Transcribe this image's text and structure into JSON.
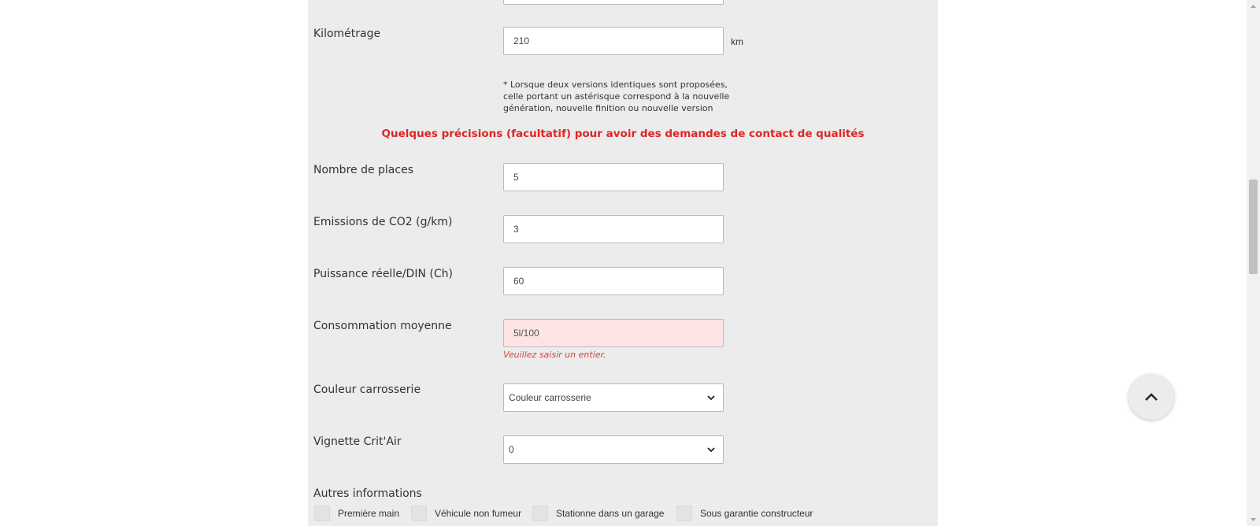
{
  "form": {
    "kilometrage": {
      "label": "Kilométrage",
      "value": "210",
      "unit": "km"
    },
    "note": "* Lorsque deux versions identiques sont proposées, celle portant un astérisque correspond à la nouvelle génération, nouvelle finition ou nouvelle version",
    "section_title": "Quelques précisions (facultatif) pour avoir des demandes de contact de qualités",
    "places": {
      "label": "Nombre de places",
      "value": "5"
    },
    "co2": {
      "label": "Emissions de CO2 (g/km)",
      "value": "3"
    },
    "puissance": {
      "label": "Puissance réelle/DIN (Ch)",
      "value": "60"
    },
    "consommation": {
      "label": "Consommation moyenne",
      "value": "5l/100",
      "error": "Veuillez saisir un entier."
    },
    "couleur": {
      "label": "Couleur carrosserie",
      "selected": "Couleur carrosserie"
    },
    "critair": {
      "label": "Vignette Crit'Air",
      "selected": "0"
    },
    "autres": {
      "label": "Autres informations",
      "options": [
        "Première main",
        "Véhicule non fumeur",
        "Stationne dans un garage",
        "Sous garantie constructeur"
      ]
    }
  },
  "colors": {
    "panel": "#ececec",
    "accent_red": "#e02424",
    "error_bg": "#fde3e4"
  },
  "icons": {
    "scroll_top": "chevron-up-icon",
    "select": "chevron-down-icon"
  }
}
